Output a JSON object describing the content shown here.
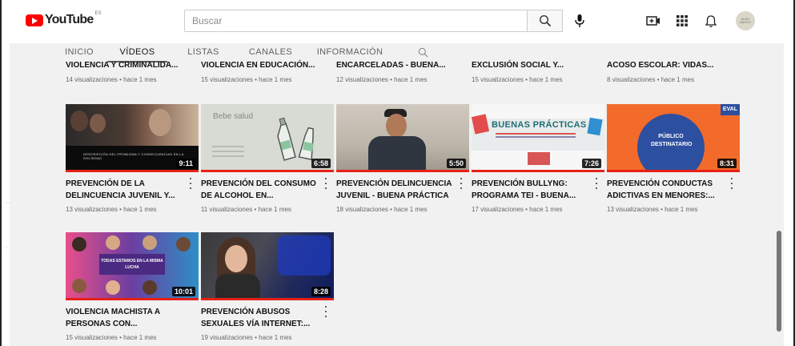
{
  "header": {
    "logo_text": "YouTube",
    "logo_country": "ES",
    "search_placeholder": "Buscar",
    "avatar_text": "ALBO ABERO"
  },
  "tabs": [
    {
      "label": "INICIO",
      "active": false
    },
    {
      "label": "VÍDEOS",
      "active": true
    },
    {
      "label": "LISTAS",
      "active": false
    },
    {
      "label": "CANALES",
      "active": false
    },
    {
      "label": "INFORMACIÓN",
      "active": false
    }
  ],
  "videos_partial_row": [
    {
      "title": "VIOLENCIA Y CRIMINALIDA...",
      "meta": "14 visualizaciones • hace 1 mes"
    },
    {
      "title": "VIOLENCIA EN EDUCACIÓN...",
      "meta": "15 visualizaciones • hace 1 mes"
    },
    {
      "title": "ENCARCELADAS - BUENA...",
      "meta": "12 visualizaciones • hace 1 mes"
    },
    {
      "title": "EXCLUSIÓN SOCIAL Y...",
      "meta": "15 visualizaciones • hace 1 mes"
    },
    {
      "title": "ACOSO ESCOLAR: VIDAS...",
      "meta": "8 visualizaciones • hace 1 mes"
    }
  ],
  "videos_row1": [
    {
      "title": "PREVENCIÓN DE LA DELINCUENCIA JUVENIL Y...",
      "meta": "13 visualizaciones • hace 1 mes",
      "duration": "9:11",
      "thumb_text": "DESCRIPCIÓN DEL PROBLEMA Y CONSECUENCIAS EN LA SOCIEDAD"
    },
    {
      "title": "PREVENCIÓN DEL CONSUMO DE ALCOHOL EN...",
      "meta": "11 visualizaciones • hace 1 mes",
      "duration": "6:58",
      "thumb_text": "Bebe salud"
    },
    {
      "title": "PREVENCIÓN DELINCUENCIA JUVENIL - BUENA PRÁCTICA",
      "meta": "18 visualizaciones • hace 1 mes",
      "duration": "5:50"
    },
    {
      "title": "PREVENCIÓN BULLYNG: PROGRAMA TEI - BUENA...",
      "meta": "17 visualizaciones • hace 1 mes",
      "duration": "7:26",
      "thumb_text": "BUENAS PRÁCTICAS"
    },
    {
      "title": "PREVENCIÓN CONDUCTAS ADICTIVAS EN MENORES:...",
      "meta": "13 visualizaciones • hace 1 mes",
      "duration": "8:31",
      "thumb_text": "PÚBLICO DESTINATARIO",
      "thumb_corner": "EVAL"
    }
  ],
  "videos_row2": [
    {
      "title": "VIOLENCIA MACHISTA A PERSONAS CON...",
      "meta": "15 visualizaciones • hace 1 mes",
      "duration": "10:01",
      "thumb_text": "TODAS ESTAMOS EN LA MISMA LUCHA"
    },
    {
      "title": "PREVENCIÓN ABUSOS SEXUALES VÍA INTERNET:...",
      "meta": "19 visualizaciones • hace 1 mes",
      "duration": "8:28"
    }
  ],
  "colors": {
    "brand_red": "#ff0000",
    "progress_red": "#e62117",
    "content_bg": "#f1f1f1"
  },
  "icons": [
    "youtube-logo-icon",
    "search-icon",
    "microphone-icon",
    "create-video-icon",
    "apps-icon",
    "notifications-bell-icon",
    "channel-search-icon",
    "more-vert-icon"
  ]
}
